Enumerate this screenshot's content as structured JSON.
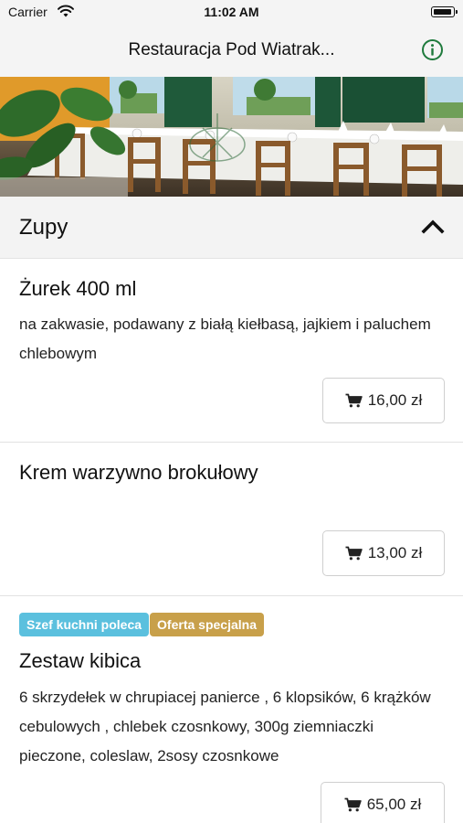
{
  "status_bar": {
    "carrier": "Carrier",
    "time": "11:02 AM",
    "icons": [
      "wifi-icon",
      "battery-icon"
    ]
  },
  "nav": {
    "title": "Restauracja Pod Wiatrak...",
    "info_icon": "info-icon",
    "accent_color": "#1e7a3c"
  },
  "hero": {
    "description_icon": "restaurant-photo"
  },
  "section": {
    "title": "Zupy",
    "toggle_icon": "chevron-up-icon"
  },
  "items": [
    {
      "name": "Żurek 400 ml",
      "description": "na zakwasie, podawany z białą kiełbasą, jajkiem i paluchem chlebowym",
      "price": "16,00 zł"
    },
    {
      "name": "Krem warzywno brokułowy",
      "description": "",
      "price": "13,00 zł"
    },
    {
      "badges": [
        "Szef kuchni poleca",
        "Oferta specjalna"
      ],
      "name": "Zestaw kibica",
      "description": "6 skrzydełek w chrupiacej panierce , 6 klopsików, 6 krążków cebulowych , chlebek czosnkowy, 300g ziemniaczki pieczone, coleslaw, 2sosy czosnkowe",
      "price": "65,00 zł"
    }
  ],
  "colors": {
    "badge_chef": "#5bc0de",
    "badge_offer": "#c8a04a",
    "header_bg": "#f3f3f3"
  }
}
